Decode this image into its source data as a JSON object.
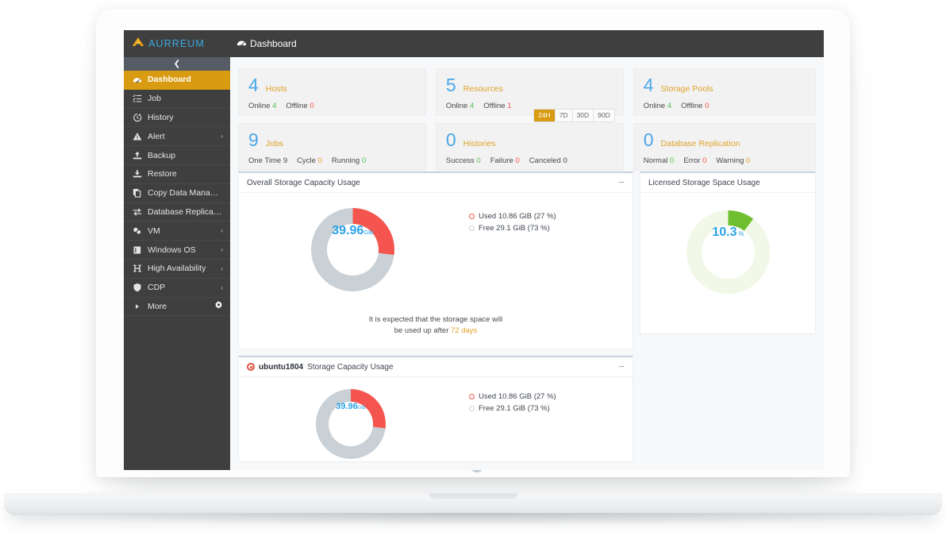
{
  "brand": {
    "name": "AURREUM",
    "logo_icon": "mountain-logo-icon",
    "accent": "#d99b11",
    "text_color": "#3ba9e0"
  },
  "topbar": {
    "page_title": "Dashboard",
    "page_icon": "dashboard-gauge-icon"
  },
  "sidebar": {
    "collapse_icon": "chevron-left-icon",
    "items": [
      {
        "label": "Dashboard",
        "icon": "dashboard-gauge-icon",
        "active": true,
        "caret": "",
        "gear": false
      },
      {
        "label": "Job",
        "icon": "list-task-icon",
        "active": false,
        "caret": "",
        "gear": false
      },
      {
        "label": "History",
        "icon": "history-clock-icon",
        "active": false,
        "caret": "",
        "gear": false
      },
      {
        "label": "Alert",
        "icon": "alert-triangle-icon",
        "active": false,
        "caret": "‹",
        "gear": false
      },
      {
        "label": "Backup",
        "icon": "upload-backup-icon",
        "active": false,
        "caret": "",
        "gear": false
      },
      {
        "label": "Restore",
        "icon": "download-restore-icon",
        "active": false,
        "caret": "",
        "gear": false
      },
      {
        "label": "Copy Data Manag…",
        "icon": "copy-documents-icon",
        "active": false,
        "caret": "",
        "gear": false
      },
      {
        "label": "Database Replica…",
        "icon": "exchange-arrows-icon",
        "active": false,
        "caret": "",
        "gear": false
      },
      {
        "label": "VM",
        "icon": "vm-cube-icon",
        "active": false,
        "caret": "‹",
        "gear": false
      },
      {
        "label": "Windows OS",
        "icon": "windows-book-icon",
        "active": false,
        "caret": "‹",
        "gear": false
      },
      {
        "label": "High Availability",
        "icon": "letter-h-icon",
        "active": false,
        "caret": "‹",
        "gear": false
      },
      {
        "label": "CDP",
        "icon": "shield-icon",
        "active": false,
        "caret": "‹",
        "gear": false
      },
      {
        "label": "More",
        "icon": "triangle-right-icon",
        "active": false,
        "caret": "",
        "gear": true
      }
    ]
  },
  "stats": {
    "cards": [
      {
        "value": "4",
        "name": "Hosts",
        "metrics": [
          {
            "label": "Online",
            "value": "4",
            "tone": "green"
          },
          {
            "label": "Offline",
            "value": "0",
            "tone": "red"
          }
        ]
      },
      {
        "value": "5",
        "name": "Resources",
        "metrics": [
          {
            "label": "Online",
            "value": "4",
            "tone": "green"
          },
          {
            "label": "Offline",
            "value": "1",
            "tone": "red"
          }
        ]
      },
      {
        "value": "4",
        "name": "Storage Pools",
        "metrics": [
          {
            "label": "Online",
            "value": "4",
            "tone": "green"
          },
          {
            "label": "Offline",
            "value": "0",
            "tone": "red"
          }
        ]
      },
      {
        "value": "9",
        "name": "Jobs",
        "metrics": [
          {
            "label": "One Time",
            "value": "9",
            "tone": "dark"
          },
          {
            "label": "Cycle",
            "value": "0",
            "tone": "orange"
          },
          {
            "label": "Running",
            "value": "0",
            "tone": "green"
          }
        ]
      },
      {
        "value": "0",
        "name": "Histories",
        "metrics": [
          {
            "label": "Success",
            "value": "0",
            "tone": "green"
          },
          {
            "label": "Failure",
            "value": "0",
            "tone": "red"
          },
          {
            "label": "Canceled",
            "value": "0",
            "tone": "dark"
          }
        ]
      },
      {
        "value": "0",
        "name": "Database Replication",
        "metrics": [
          {
            "label": "Normal",
            "value": "0",
            "tone": "green"
          },
          {
            "label": "Error",
            "value": "0",
            "tone": "red"
          },
          {
            "label": "Warning",
            "value": "0",
            "tone": "orange"
          }
        ]
      }
    ],
    "range_buttons": [
      {
        "label": "24H",
        "active": true
      },
      {
        "label": "7D",
        "active": false
      },
      {
        "label": "30D",
        "active": false
      },
      {
        "label": "90D",
        "active": false
      }
    ]
  },
  "panels": {
    "overall": {
      "title": "Overall Storage Capacity Usage",
      "minimize_icon": "minimize-dash-icon",
      "center_value": "39.96",
      "center_unit": "GiB",
      "legend": [
        {
          "label": "Used 10.86 GiB (27 %)",
          "color": "#f4564f"
        },
        {
          "label": "Free 29.1 GiB (73 %)",
          "color": "#c9d1d6"
        }
      ],
      "forecast_line1": "It is expected that the storage space will",
      "forecast_line2_prefix": "be used up after",
      "forecast_days": "72 days"
    },
    "licensed": {
      "title": "Licensed Storage Space Usage",
      "center_value": "10.3",
      "center_unit": "%"
    },
    "ubuntu": {
      "title_strong": "ubuntu1804",
      "title_rest": "Storage Capacity Usage",
      "badge_icon": "ubuntu-target-icon",
      "minimize_icon": "minimize-dash-icon",
      "center_value": "39.96",
      "center_unit": "GiB",
      "legend": [
        {
          "label": "Used 10.86 GiB (27 %)",
          "color": "#f4564f"
        },
        {
          "label": "Free 29.1 GiB (73 %)",
          "color": "#c9d1d6"
        }
      ]
    }
  },
  "chart_data": [
    {
      "type": "pie",
      "title": "Overall Storage Capacity Usage",
      "labels": [
        "Used",
        "Free"
      ],
      "values": [
        10.86,
        29.1
      ],
      "percentages": [
        27,
        73
      ],
      "unit": "GiB",
      "total": 39.96,
      "colors": [
        "#f4564f",
        "#c9d1d6"
      ],
      "center_label": "39.96 GiB",
      "legend_position": "right",
      "annotation": "It is expected that the storage space will be used up after 72 days"
    },
    {
      "type": "pie",
      "title": "Licensed Storage Space Usage",
      "labels": [
        "Used",
        "Free"
      ],
      "values": [
        10.3,
        89.7
      ],
      "percentages": [
        10.3,
        89.7
      ],
      "unit": "%",
      "colors": [
        "#6fbe2f",
        "#f1f8e7"
      ],
      "center_label": "10.3 %",
      "legend_position": "none"
    },
    {
      "type": "pie",
      "title": "ubuntu1804 Storage Capacity Usage",
      "labels": [
        "Used",
        "Free"
      ],
      "values": [
        10.86,
        29.1
      ],
      "percentages": [
        27,
        73
      ],
      "unit": "GiB",
      "total": 39.96,
      "colors": [
        "#f4564f",
        "#c9d1d6"
      ],
      "center_label": "39.96 GiB",
      "legend_position": "right"
    }
  ]
}
